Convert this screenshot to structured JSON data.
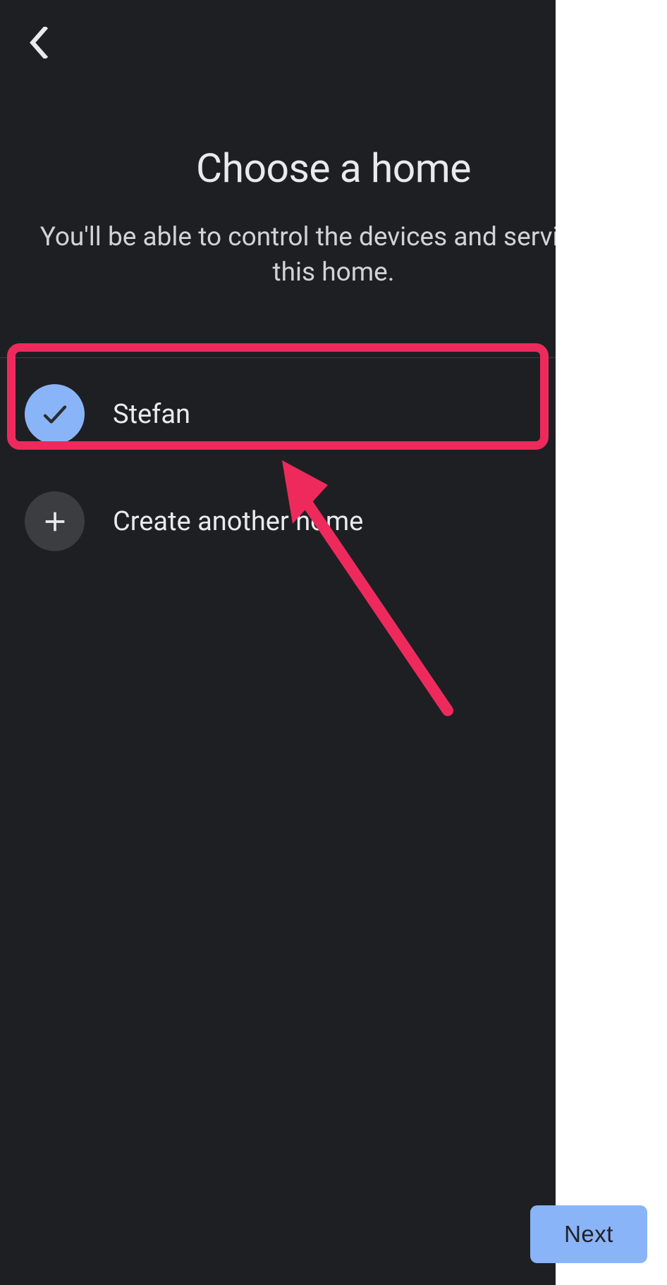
{
  "header": {
    "title": "Choose a home",
    "subtitle": "You'll be able to control the devices and services in this home."
  },
  "homes": [
    {
      "label": "Stefan",
      "selected": true
    },
    {
      "label": "Create another home",
      "selected": false
    }
  ],
  "footer": {
    "next_label": "Next"
  },
  "colors": {
    "background": "#1e1f22",
    "accent": "#8ab4f8",
    "highlight": "#ee2a5d",
    "text": "#e8eaed"
  }
}
